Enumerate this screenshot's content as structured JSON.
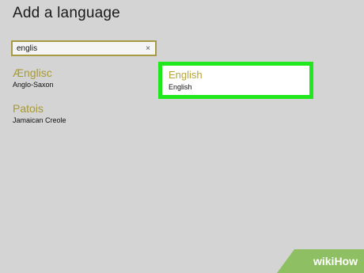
{
  "dialog": {
    "title": "Add a language"
  },
  "search": {
    "value": "englis",
    "clear_glyph": "×"
  },
  "languages": [
    {
      "name": "Ænglisc",
      "native": "Anglo-Saxon"
    },
    {
      "name": "English",
      "native": "English",
      "highlighted": true
    },
    {
      "name": "Patois",
      "native": "Jamaican Creole"
    }
  ],
  "colors": {
    "highlight_border": "#21e81d",
    "language_name": "#a89a2e",
    "background": "#d4d4d4"
  },
  "watermark": {
    "part1": "wiki",
    "part2": "How"
  }
}
